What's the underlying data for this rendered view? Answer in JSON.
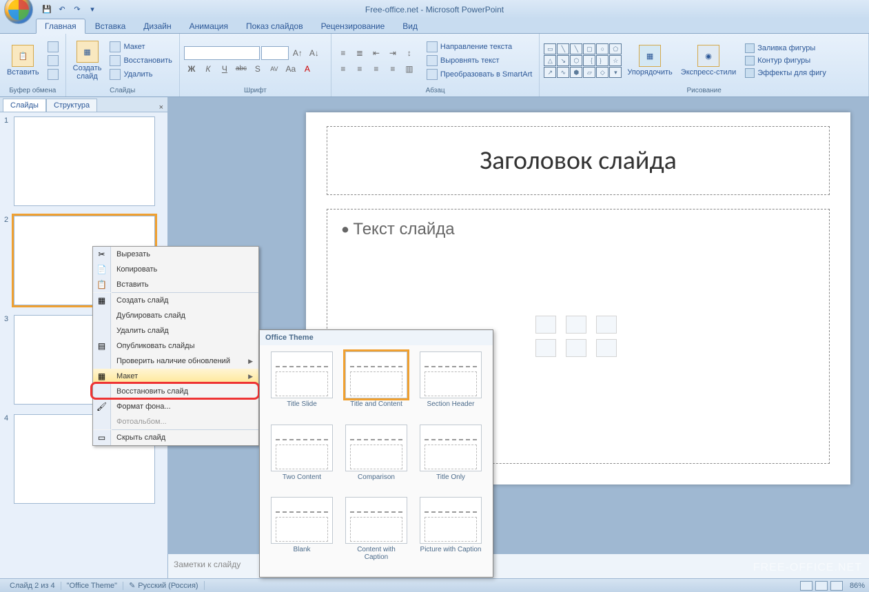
{
  "title": "Free-office.net - Microsoft PowerPoint",
  "tabs": [
    "Главная",
    "Вставка",
    "Дизайн",
    "Анимация",
    "Показ слайдов",
    "Рецензирование",
    "Вид"
  ],
  "active_tab": 0,
  "ribbon": {
    "clipboard": {
      "paste": "Вставить",
      "label": "Буфер обмена"
    },
    "slides": {
      "new": "Создать\nслайд",
      "layout": "Макет",
      "reset": "Восстановить",
      "delete": "Удалить",
      "label": "Слайды"
    },
    "font": {
      "label": "Шрифт",
      "bold": "Ж",
      "italic": "К",
      "underline": "Ч",
      "strike": "abc",
      "shadow": "S",
      "spacing": "AV",
      "case": "Aa",
      "clear": "A"
    },
    "paragraph": {
      "label": "Абзац",
      "textdir": "Направление текста",
      "align": "Выровнять текст",
      "smartart": "Преобразовать в SmartArt"
    },
    "drawing": {
      "label": "Рисование",
      "arrange": "Упорядочить",
      "styles": "Экспресс-стили",
      "fill": "Заливка фигуры",
      "outline": "Контур фигуры",
      "effects": "Эффекты для фигу"
    }
  },
  "side_tabs": {
    "slides": "Слайды",
    "outline": "Структура"
  },
  "slide_count": 4,
  "selected_slide": 2,
  "slide": {
    "title": "Заголовок слайда",
    "body": "Текст слайда"
  },
  "notes_placeholder": "Заметки к слайду",
  "context_menu": [
    {
      "icon": "✂",
      "label": "Вырезать"
    },
    {
      "icon": "📄",
      "label": "Копировать"
    },
    {
      "icon": "📋",
      "label": "Вставить"
    },
    {
      "sep": true
    },
    {
      "icon": "▦",
      "label": "Создать слайд"
    },
    {
      "icon": "",
      "label": "Дублировать слайд"
    },
    {
      "icon": "",
      "label": "Удалить слайд"
    },
    {
      "icon": "▤",
      "label": "Опубликовать слайды"
    },
    {
      "icon": "",
      "label": "Проверить наличие обновлений",
      "arrow": true
    },
    {
      "icon": "▦",
      "label": "Макет",
      "arrow": true,
      "highlighted": true
    },
    {
      "icon": "",
      "label": "Восстановить слайд"
    },
    {
      "icon": "🖌",
      "label": "Формат фона..."
    },
    {
      "icon": "",
      "label": "Фотоальбом...",
      "disabled": true
    },
    {
      "sep": true
    },
    {
      "icon": "▭",
      "label": "Скрыть слайд"
    }
  ],
  "layout_flyout": {
    "header": "Office Theme",
    "items": [
      "Title Slide",
      "Title and Content",
      "Section Header",
      "Two Content",
      "Comparison",
      "Title Only",
      "Blank",
      "Content with Caption",
      "Picture with Caption"
    ],
    "selected": 1
  },
  "status": {
    "slide": "Слайд 2 из 4",
    "theme": "\"Office Theme\"",
    "lang": "Русский (Россия)",
    "zoom": "86%"
  },
  "watermark": "FREE-OFFICE.NET"
}
